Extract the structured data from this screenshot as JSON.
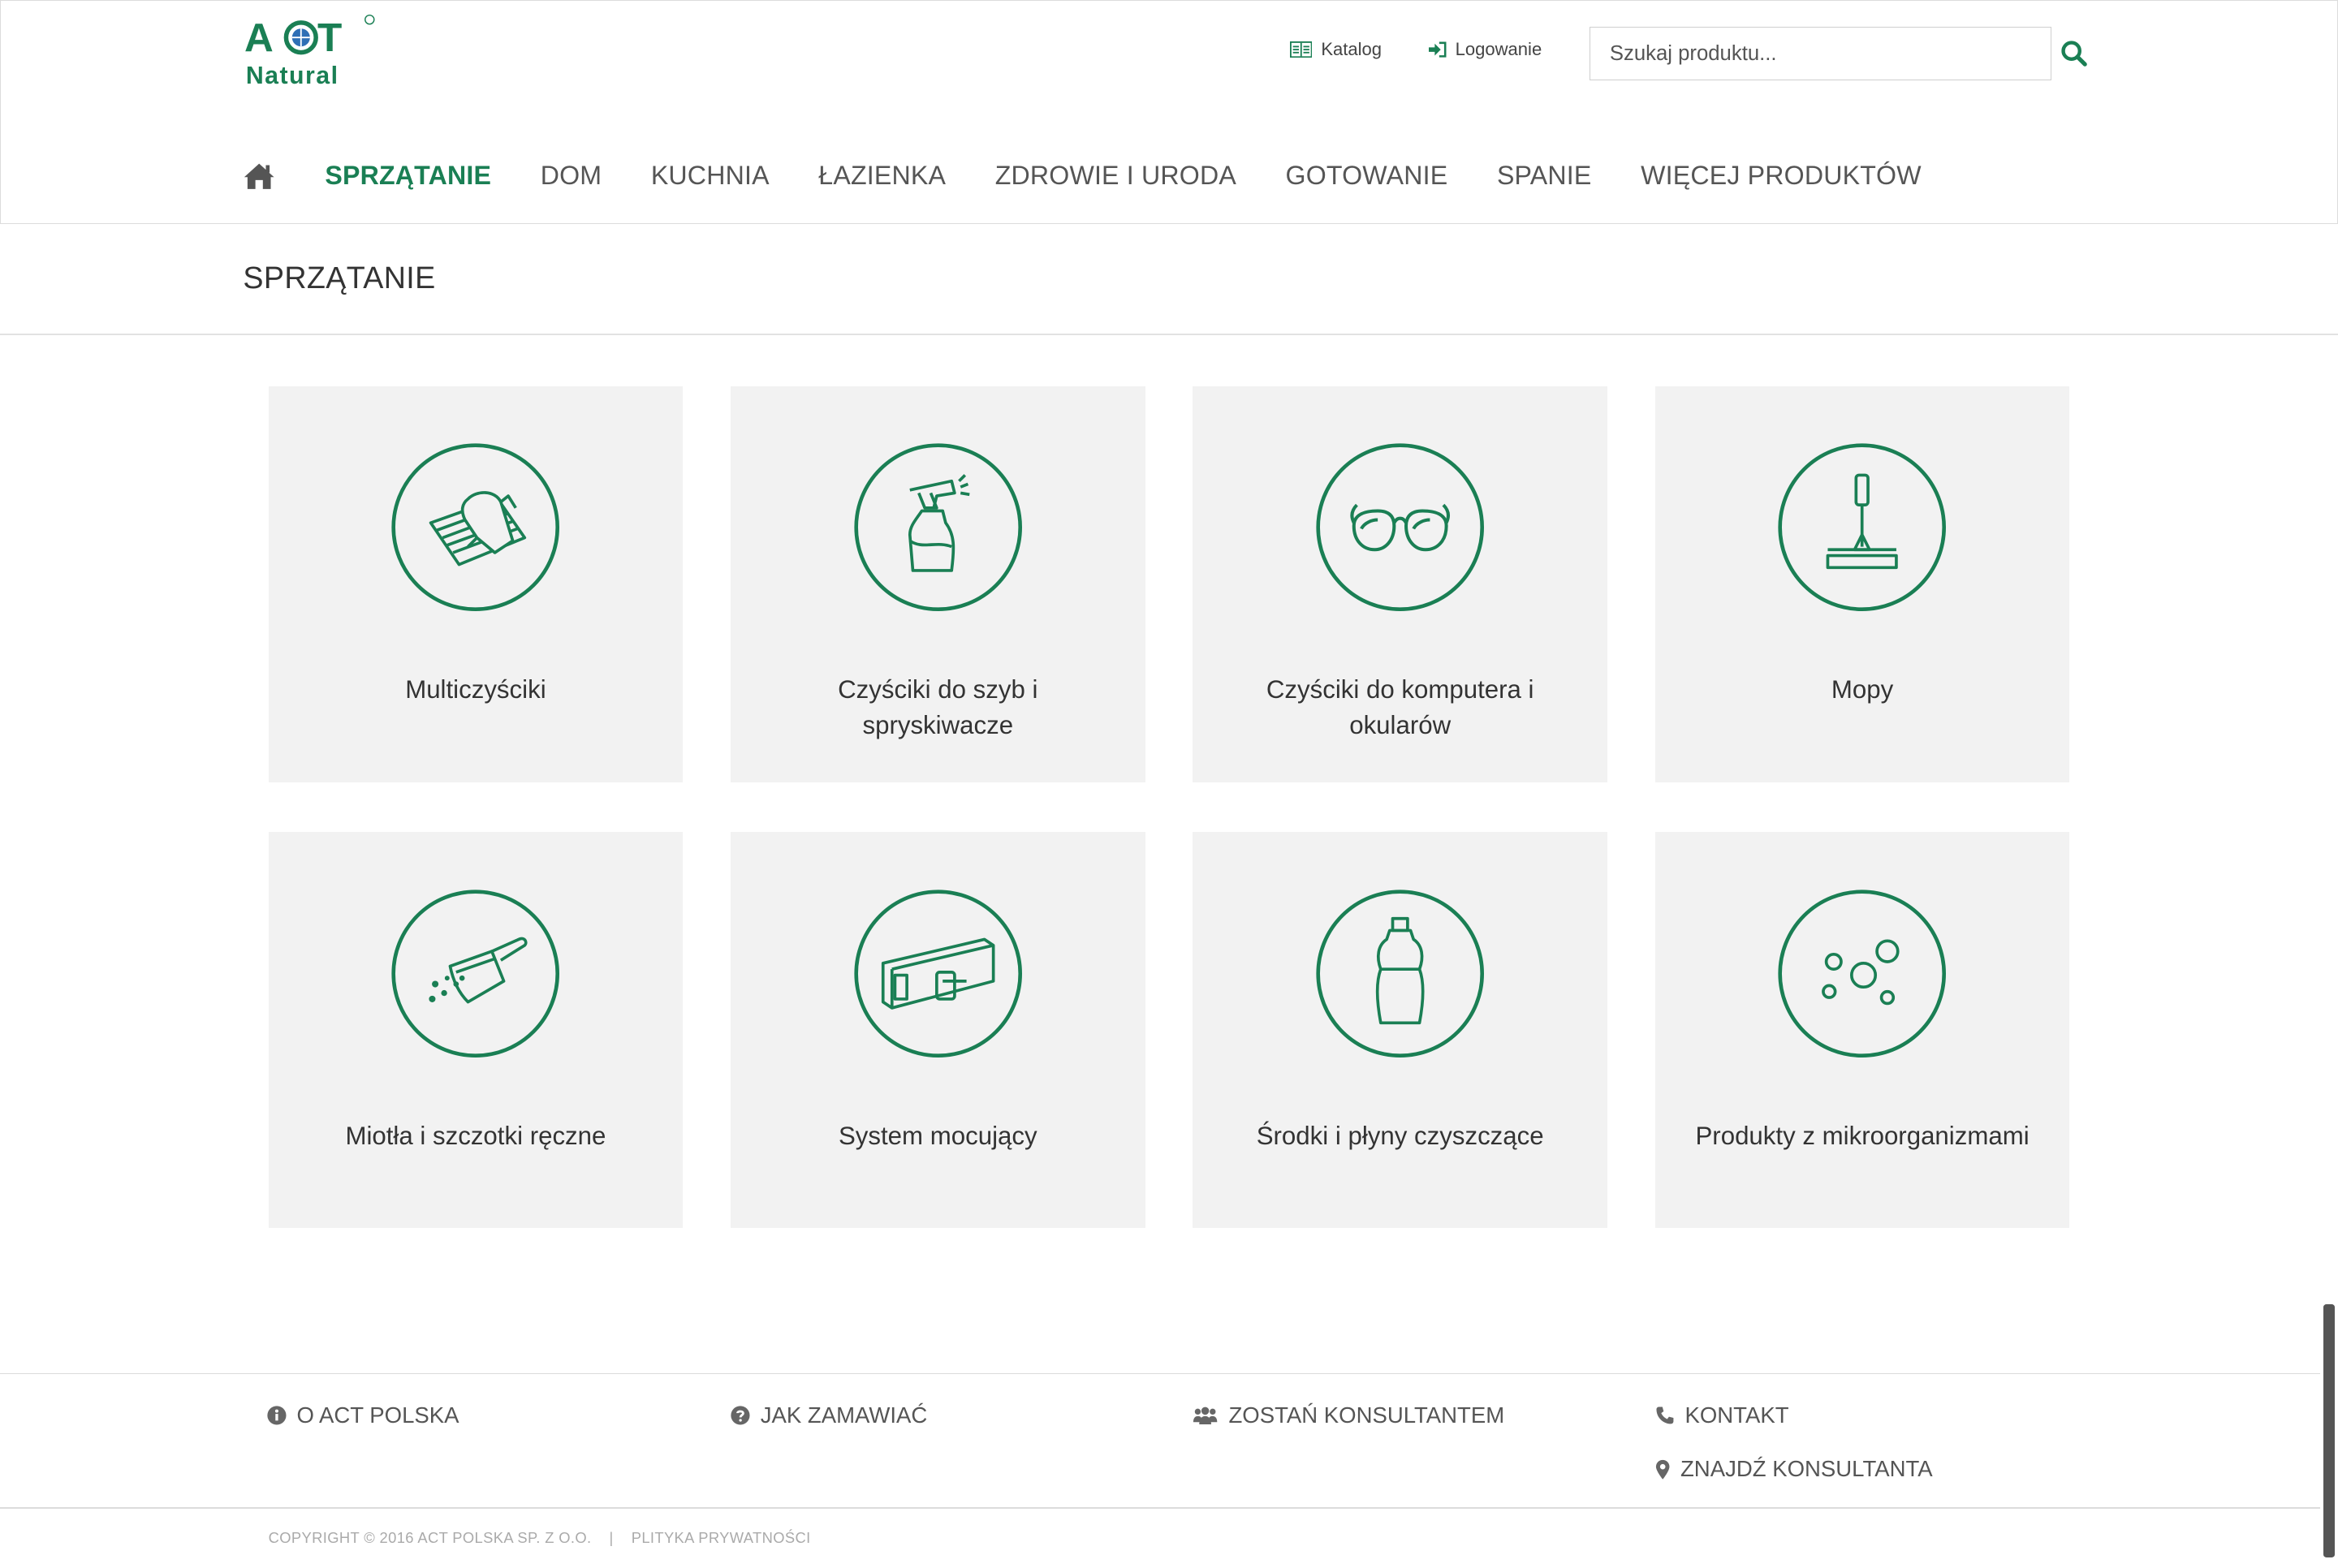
{
  "brand": {
    "logo_top": "ACT",
    "logo_bottom": "Natural",
    "green": "#1a7f54"
  },
  "header": {
    "katalog_label": "Katalog",
    "login_label": "Logowanie",
    "search_placeholder": "Szukaj produktu...",
    "search_icon": "search-icon"
  },
  "nav": {
    "home_icon": "home-icon",
    "items": [
      {
        "label": "SPRZĄTANIE",
        "active": true
      },
      {
        "label": "DOM"
      },
      {
        "label": "KUCHNIA"
      },
      {
        "label": "ŁAZIENKA"
      },
      {
        "label": "ZDROWIE I URODA"
      },
      {
        "label": "GOTOWANIE"
      },
      {
        "label": "SPANIE"
      },
      {
        "label": "WIĘCEJ PRODUKTÓW"
      }
    ]
  },
  "page": {
    "title": "SPRZĄTANIE"
  },
  "categories": [
    {
      "label": "Multiczyściki",
      "icon": "cleaning-cloth-icon"
    },
    {
      "label": "Czyściki do szyb i spryskiwacze",
      "icon": "spray-bottle-icon"
    },
    {
      "label": "Czyściki do komputera i okularów",
      "icon": "glasses-icon"
    },
    {
      "label": "Mopy",
      "icon": "mop-icon"
    },
    {
      "label": "Miotła i szczotki ręczne",
      "icon": "dustpan-icon"
    },
    {
      "label": "System mocujący",
      "icon": "mounting-rail-icon"
    },
    {
      "label": "Środki i płyny czyszczące",
      "icon": "detergent-bottle-icon"
    },
    {
      "label": "Produkty z mikroorganizmami",
      "icon": "microorganisms-icon"
    }
  ],
  "footer": {
    "links": [
      {
        "label": "O ACT POLSKA",
        "icon": "info-icon"
      },
      {
        "label": "JAK ZAMAWIAĆ",
        "icon": "question-icon"
      },
      {
        "label": "ZOSTAŃ KONSULTANTEM",
        "icon": "users-icon"
      },
      {
        "label": "KONTAKT",
        "icon": "phone-icon"
      },
      {
        "label": "ZNAJDŹ KONSULTANTA",
        "icon": "map-marker-icon"
      }
    ],
    "copyright": "COPYRIGHT © 2016 ACT POLSKA SP. Z O.O.",
    "separator": "|",
    "privacy": "PLITYKA PRYWATNOŚCI"
  }
}
